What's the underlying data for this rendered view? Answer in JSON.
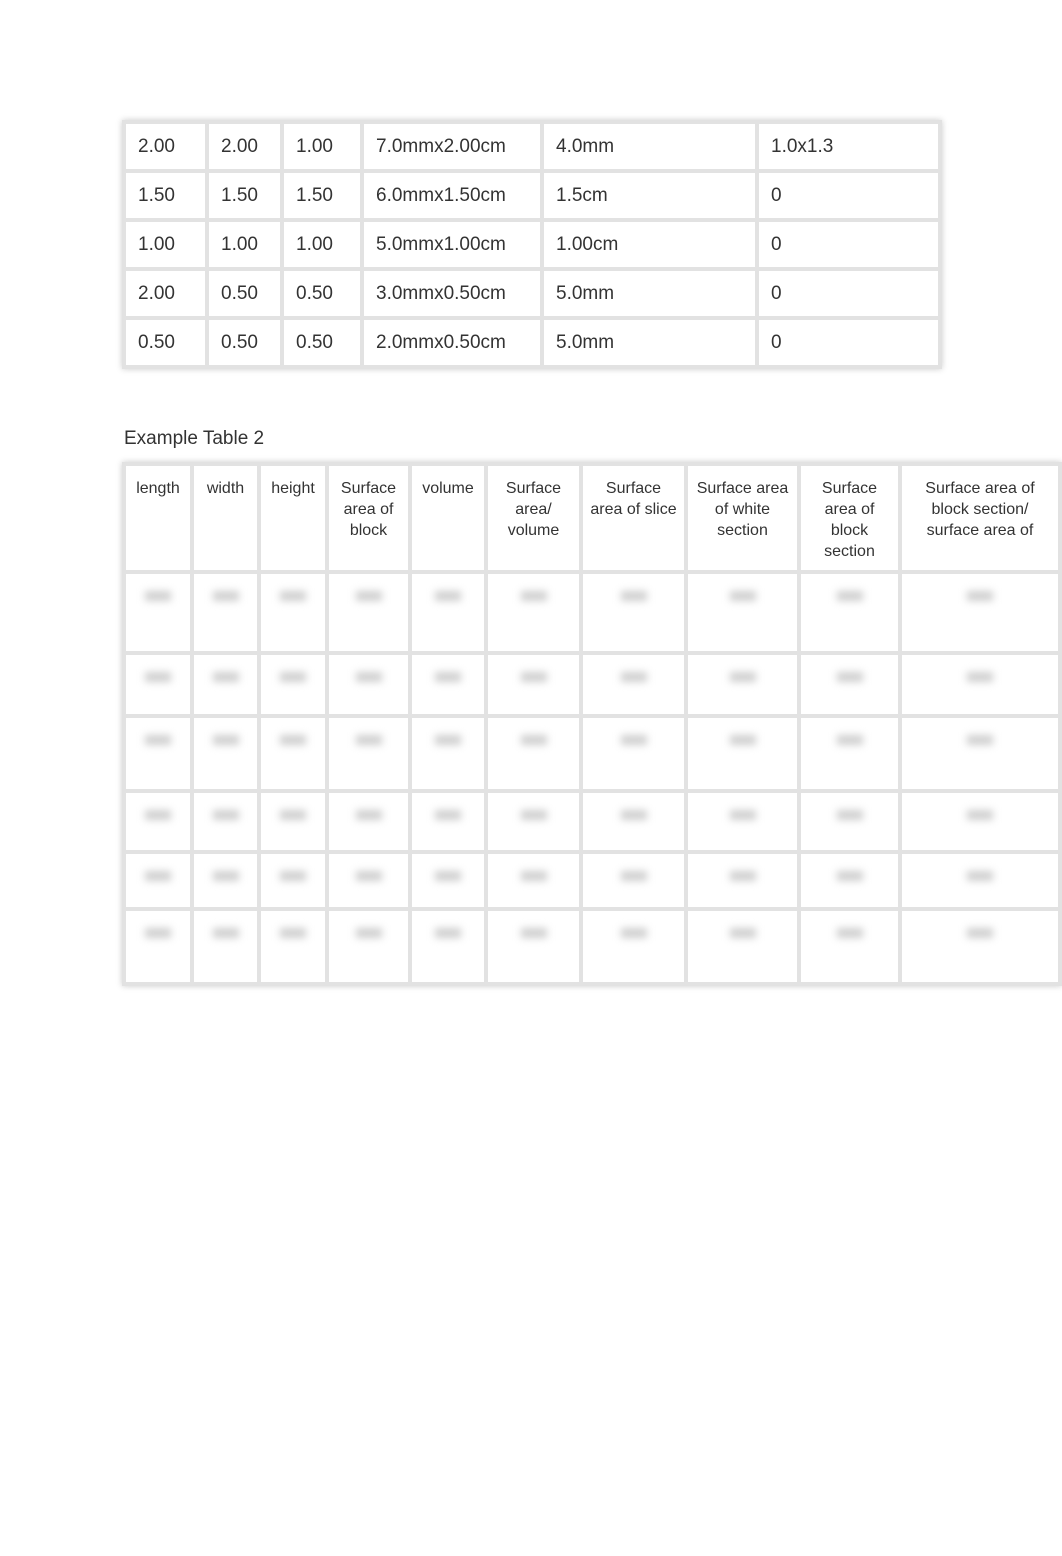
{
  "table1": {
    "rows": [
      [
        "2.00",
        "2.00",
        "1.00",
        "7.0mmx2.00cm",
        "4.0mm",
        "1.0x1.3"
      ],
      [
        "1.50",
        "1.50",
        "1.50",
        "6.0mmx1.50cm",
        "1.5cm",
        "0"
      ],
      [
        "1.00",
        "1.00",
        "1.00",
        "5.0mmx1.00cm",
        "1.00cm",
        "0"
      ],
      [
        "2.00",
        "0.50",
        "0.50",
        "3.0mmx0.50cm",
        "5.0mm",
        "0"
      ],
      [
        "0.50",
        "0.50",
        "0.50",
        "2.0mmx0.50cm",
        "5.0mm",
        "0"
      ]
    ]
  },
  "table2": {
    "caption": "Example Table 2",
    "headers": [
      "length",
      "width",
      "height",
      "Surface area of block",
      "volume",
      "Surface area/ volume",
      "Surface area of slice",
      "Surface area of white section",
      "Surface area of block section",
      "Surface area of block section/ surface area of"
    ]
  }
}
